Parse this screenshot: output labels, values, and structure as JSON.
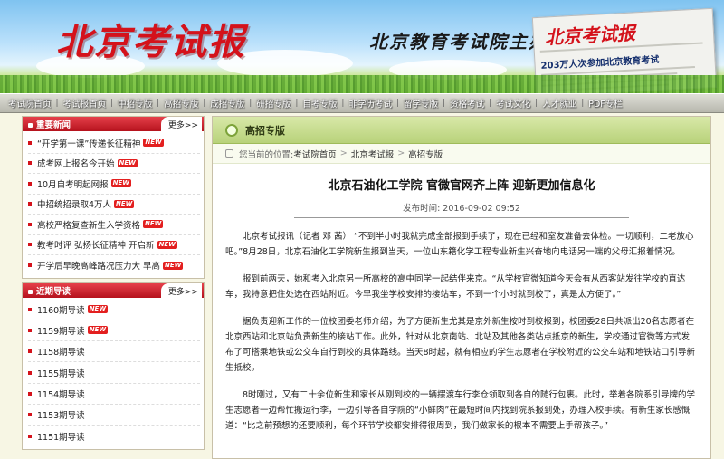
{
  "banner": {
    "logo": "北京考试报",
    "publisher": "北京教育考试院主办",
    "paper_masthead": "北京考试报",
    "paper_headline": "203万人次参加北京教育考试"
  },
  "nav": {
    "items": [
      "考试院首页",
      "考试报首页",
      "中招专版",
      "高招专版",
      "成招专版",
      "研招专版",
      "自考专版",
      "非学历考试",
      "留学专版",
      "资格考试",
      "考试文化",
      "人才就业",
      "PDF专栏"
    ]
  },
  "news_box": {
    "title": "重要新闻",
    "more": "更多>>",
    "items": [
      {
        "text": "“开学第一课”传递长征精神",
        "new": true
      },
      {
        "text": "成考网上报名今开始",
        "new": true
      },
      {
        "text": "10月自考明起网报",
        "new": true
      },
      {
        "text": "中招统招录取4万人",
        "new": true
      },
      {
        "text": "高校严格复查新生入学资格",
        "new": true
      },
      {
        "text": "教考时评 弘扬长征精神 开启新",
        "new": true
      },
      {
        "text": "开学后早晚高峰路况压力大 早高",
        "new": true
      }
    ]
  },
  "issues_box": {
    "title": "近期导读",
    "more": "更多>>",
    "items": [
      {
        "text": "1160期导读",
        "new": true
      },
      {
        "text": "1159期导读",
        "new": true
      },
      {
        "text": "1158期导读",
        "new": false
      },
      {
        "text": "1155期导读",
        "new": false
      },
      {
        "text": "1154期导读",
        "new": false
      },
      {
        "text": "1153期导读",
        "new": false
      },
      {
        "text": "1151期导读",
        "new": false
      }
    ]
  },
  "new_badge": "NEW",
  "section": {
    "title": "高招专版",
    "breadcrumb_prefix": "您当前的位置:",
    "breadcrumb": [
      "考试院首页",
      "北京考试报",
      "高招专版"
    ]
  },
  "article": {
    "title": "北京石油化工学院 官微官网齐上阵 迎新更加信息化",
    "pubdate": "发布时间: 2016-09-02 09:52",
    "paragraphs": [
      "北京考试报讯（记者 邓 茜） “不到半小时我就完成全部报到手续了，现在已经和室友准备去体检。一切顺利，二老放心吧。”8月28日，北京石油化工学院新生报到当天，一位山东籍化学工程专业新生兴奋地向电话另一端的父母汇报着情况。",
      "报到前两天，她和考入北京另一所高校的高中同学一起结伴来京。“从学校官微知道今天会有从西客站发往学校的直达车，我特意把住处选在西站附近。今早我坐学校安排的接站车，不到一个小时就到校了，真是太方便了。”",
      "据负责迎新工作的一位校团委老师介绍，为了方便新生尤其是京外新生按时到校报到，校团委28日共派出20名志愿者在北京西站和北京站负责新生的接站工作。此外，针对从北京南站、北站及其他各类站点抵京的新生，学校通过官微等方式发布了可搭乘地铁或公交车自行到校的具体路线。当天8时起，就有相应的学生志愿者在学校附近的公交车站和地铁站口引导新生抵校。",
      "8时刚过，又有二十余位新生和家长从刚到校的一辆摆渡车行李仓领取到各自的随行包裹。此时，举着各院系引导牌的学生志愿者一边帮忙搬运行李，一边引导各自学院的“小鲜肉”在最短时间内找到院系报到处，办理入校手续。有新生家长感慨道：“比之前预想的还要顺利，每个环节学校都安排得很周到，我们做家长的根本不需要上手帮孩子。”"
    ]
  },
  "colors": {
    "brand_red": "#d4121b",
    "header_green": "#b8d27a",
    "page_bg": "#f7f6e4"
  }
}
